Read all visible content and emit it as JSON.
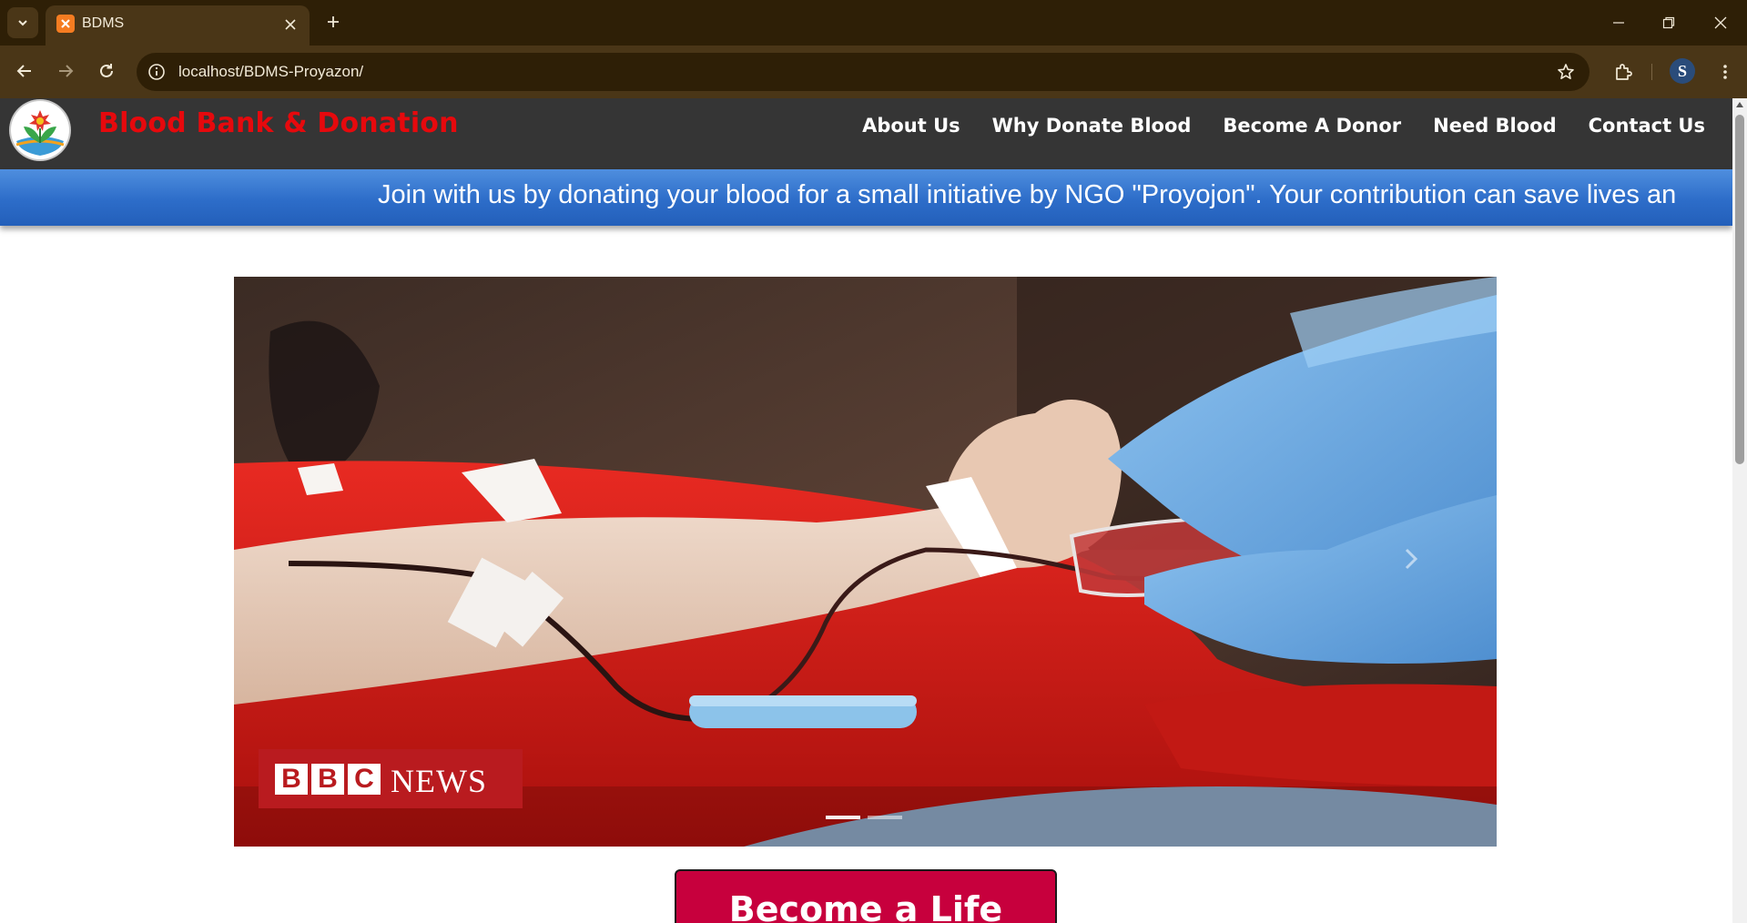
{
  "browser": {
    "tab_title": "BDMS",
    "url": "localhost/BDMS-Proyazon/",
    "profile_initial": "S"
  },
  "site": {
    "brand": "Blood Bank & Donation",
    "nav": [
      "About Us",
      "Why Donate Blood",
      "Become A Donor",
      "Need Blood",
      "Contact Us"
    ],
    "marquee": "Join with us by donating your blood for a small initiative by NGO \"Proyojon\". Your contribution can save lives an",
    "carousel": {
      "watermark_news": "NEWS",
      "watermark_letters": [
        "B",
        "B",
        "C"
      ],
      "active_slide": 1,
      "slide_count": 2
    },
    "cta": "Become a Life Saver"
  },
  "colors": {
    "brand_red": "#e6090d",
    "header_bg": "#353535",
    "marquee_blue": "#2d6dc9",
    "cta_bg": "#c7003d"
  },
  "icons": {
    "tab_dropdown": "chevron-down-icon",
    "tab_close": "close-icon",
    "new_tab": "plus-icon",
    "back": "arrow-left-icon",
    "forward": "arrow-right-icon",
    "reload": "reload-icon",
    "site_info": "info-icon",
    "bookmark": "star-icon",
    "extensions": "puzzle-icon",
    "menu": "kebab-menu-icon"
  }
}
